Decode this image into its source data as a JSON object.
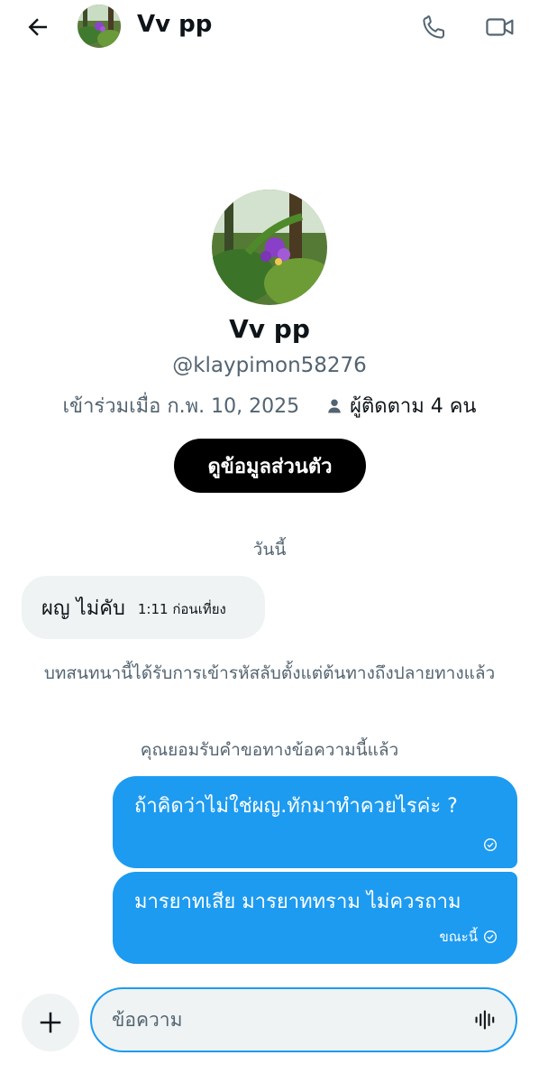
{
  "header": {
    "name": "Vv pp",
    "back_icon": "arrow-left-icon",
    "call_icon": "phone-icon",
    "video_icon": "video-camera-icon"
  },
  "profile": {
    "name": "Vv pp",
    "handle": "@klaypimon58276",
    "joined": "เข้าร่วมเมื่อ ก.พ. 10, 2025",
    "followers": "ผู้ติดตาม 4 คน",
    "view_profile_label": "ดูข้อมูลส่วนตัว"
  },
  "conversation": {
    "day_label": "วันนี้",
    "incoming": [
      {
        "text": "ผญ ไม่คับ",
        "time": "1:11 ก่อนเที่ยง"
      }
    ],
    "e2e_notice": "บทสนทนานี้ได้รับการเข้ารหัสลับตั้งแต่ต้นทางถึงปลายทางแล้ว",
    "accepted_notice": "คุณยอมรับคำขอทางข้อความนี้แล้ว",
    "outgoing": [
      {
        "text": "ถ้าคิดว่าไม่ใช่ผญ.ทักมาทำควยไรค่ะ ?",
        "time": ""
      },
      {
        "text": "มารยาทเสีย มารยาททราม ไม่ควรถาม",
        "time": "ขณะนี้"
      }
    ]
  },
  "composer": {
    "placeholder": "ข้อความ",
    "plus_icon": "plus-icon",
    "voice_icon": "voice-wave-icon"
  },
  "colors": {
    "accent": "#1d9bf0",
    "bubble_incoming": "#eff3f4",
    "secondary_text": "#536471"
  }
}
